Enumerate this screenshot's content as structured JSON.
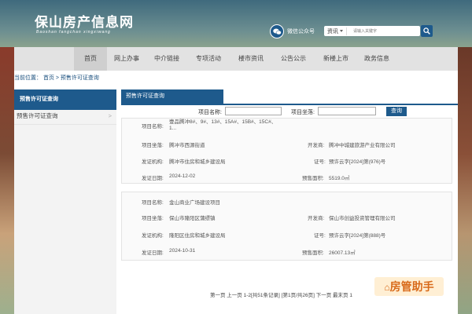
{
  "site": {
    "logo_title": "保山房产信息网",
    "logo_subtitle": "Baoshan fangchan xingxiwang",
    "wechat_label": "微信公众号",
    "search_type": "资讯",
    "search_placeholder": "请输入关键字"
  },
  "nav": [
    {
      "label": "首页",
      "active": true
    },
    {
      "label": "网上办事"
    },
    {
      "label": "中介链接"
    },
    {
      "label": "专项活动"
    },
    {
      "label": "楼市资讯"
    },
    {
      "label": "公告公示"
    },
    {
      "label": "新楼上市"
    },
    {
      "label": "政务信息"
    }
  ],
  "breadcrumb": "当前位置： 首页 > 预售许可证查询",
  "sidebar": {
    "header": "预售许可证查询",
    "items": [
      {
        "label": "预售许可证查询",
        "chevron": ">"
      }
    ]
  },
  "main_tab": "预售许可证查询",
  "filter": {
    "name_label": "项目名称:",
    "location_label": "项目坐落:",
    "search_button": "查询"
  },
  "records": [
    {
      "name_label": "项目名称:",
      "name": "壹品腾冲8#、9#、13#、15A#、15B#、15C#、1...",
      "location_label": "项目坐落:",
      "location": "腾冲市西源街道",
      "developer_label": "开发商:",
      "developer": "腾冲中城建旅游产业有限公司",
      "authority_label": "发证机构:",
      "authority": "腾冲市住房和城乡建设局",
      "cert_label": "证号:",
      "cert": "预许云字[2024]第(976)号",
      "date_label": "发证日期:",
      "date": "2024-12-02",
      "area_label": "预售面积:",
      "area": "5519.0㎡"
    },
    {
      "name_label": "项目名称:",
      "name": "金山商业广场建设项目",
      "location_label": "项目坐落:",
      "location": "保山市隆阳区蒲缥镇",
      "developer_label": "开发商:",
      "developer": "保山市创益投资管理有限公司",
      "authority_label": "发证机构:",
      "authority": "隆阳区住房和城乡建设局",
      "cert_label": "证号:",
      "cert": "预许云字[2024]第(888)号",
      "date_label": "发证日期:",
      "date": "2024-10-31",
      "area_label": "预售面积:",
      "area": "26007.13㎡"
    }
  ],
  "pager": "第一页 上一页 1-2[共51条记录] [第1页/共26页] 下一页 最末页 1",
  "watermark": "房管助手",
  "colors": {
    "brand": "#1e5a8c",
    "nav_bg": "#e2e2e2"
  }
}
